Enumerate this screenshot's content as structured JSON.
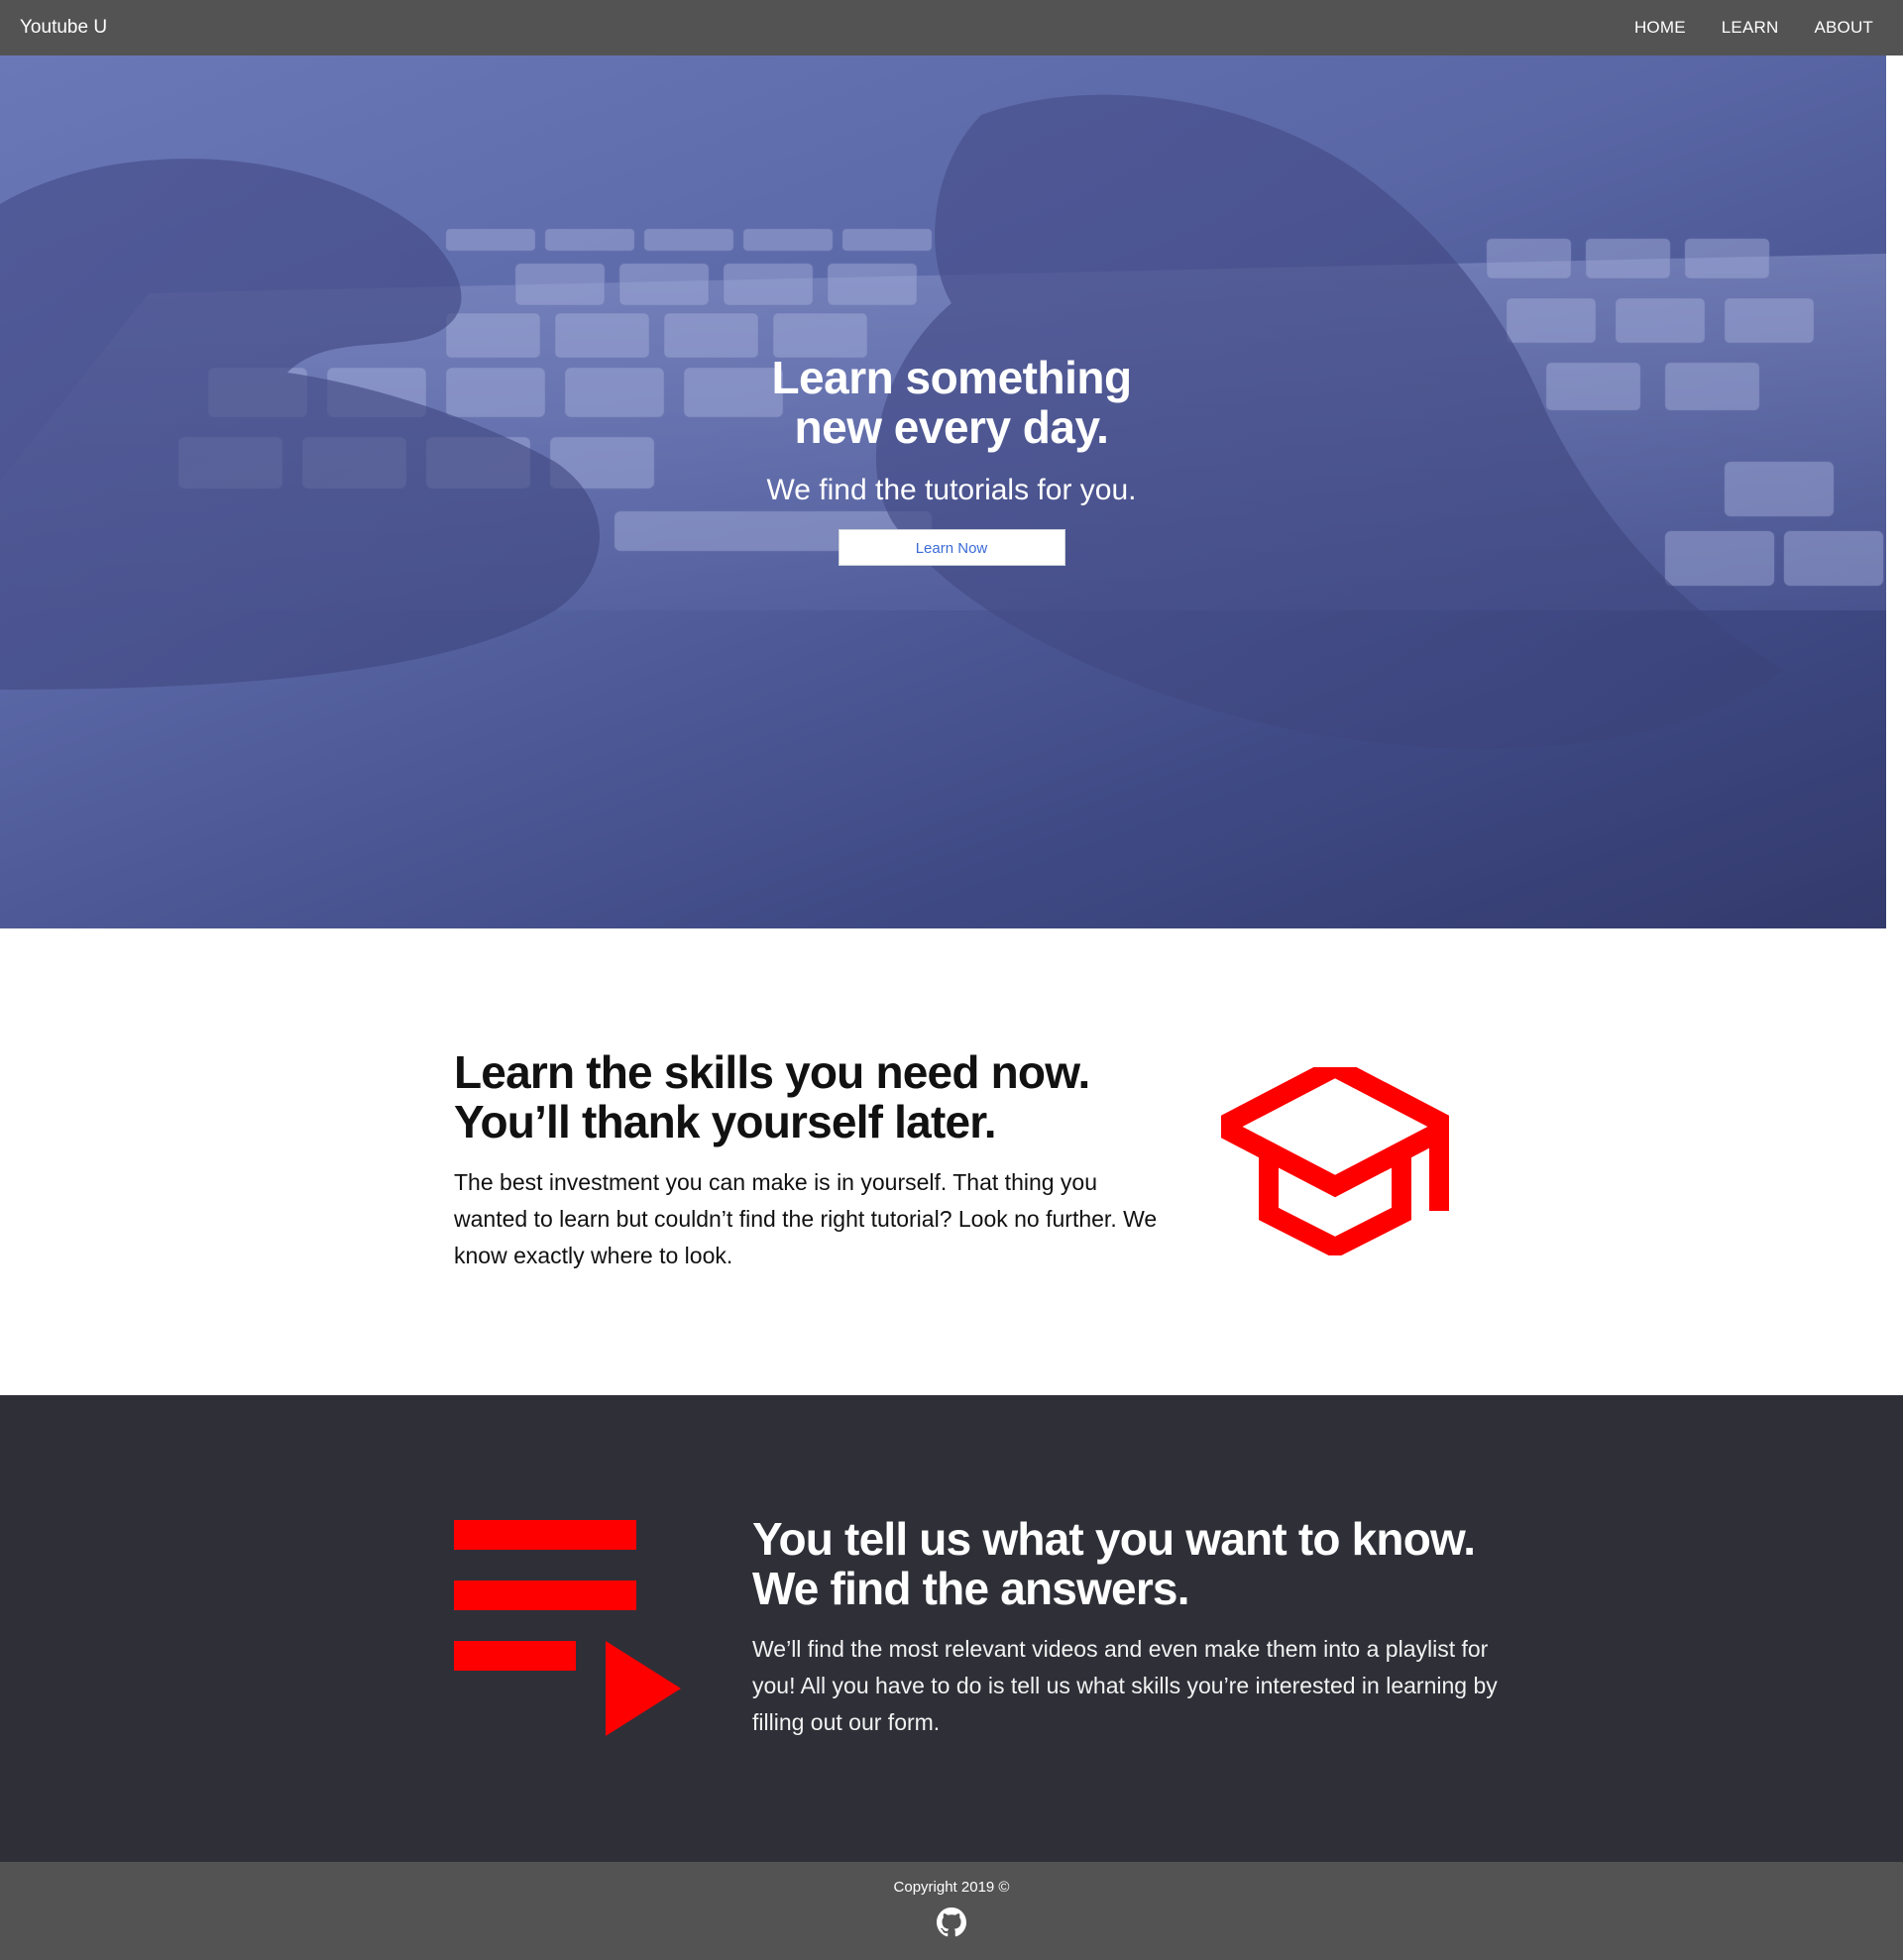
{
  "navbar": {
    "brand": "Youtube U",
    "links": [
      {
        "label": "HOME"
      },
      {
        "label": "LEARN"
      },
      {
        "label": "ABOUT"
      }
    ]
  },
  "hero": {
    "title_line1": "Learn something",
    "title_line2": "new every day.",
    "subtitle": "We find the tutorials for you.",
    "button_label": "Learn Now"
  },
  "skills": {
    "title_line1": "Learn the skills you need now.",
    "title_line2": "You’ll thank yourself later.",
    "body": "The best investment you can make is in yourself. That thing you wanted to learn but couldn’t find the right tutorial? Look no further. We know exactly where to look.",
    "icon": "graduation-cap-icon"
  },
  "playlist": {
    "title_line1": "You tell us what you want to know.",
    "title_line2": "We find the answers.",
    "body": "We’ll find the most relevant videos and even make them into a playlist for you! All you have to do is tell us what skills you’re interested in learning by filling out our form.",
    "icon": "playlist-play-icon"
  },
  "footer": {
    "copyright": "Copyright 2019 ©",
    "icon": "github-icon"
  },
  "colors": {
    "navbar": "#535353",
    "accent_red": "#ff0000",
    "dark_section": "#2f2f38",
    "button_text": "#3b6bd6"
  }
}
